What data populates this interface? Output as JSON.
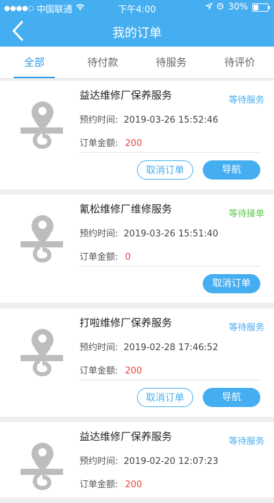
{
  "status_bar": {
    "carrier": "中国联通",
    "time": "下午4:00",
    "battery": "30%"
  },
  "header": {
    "title": "我的订单"
  },
  "tabs": [
    {
      "label": "全部",
      "active": true
    },
    {
      "label": "待付款"
    },
    {
      "label": "待服务"
    },
    {
      "label": "待评价"
    }
  ],
  "colors": {
    "primary": "#45aef0",
    "status_waiting_service": "#45aef0",
    "status_waiting_accept": "#5ac84a",
    "amount": "#e2463d"
  },
  "labels": {
    "time": "预约时间:",
    "amount": "订单金额:"
  },
  "orders": [
    {
      "name": "益达维修厂保养服务",
      "status": "等待服务",
      "time": "2019-03-26 15:52:46",
      "amount": "200",
      "cancel_label": "取消订单",
      "nav_label": "导航"
    },
    {
      "name": "氰松维修厂维修服务",
      "status": "等待接单",
      "time": "2019-03-26 15:51:40",
      "amount": "0",
      "cancel_label": "取消订单"
    },
    {
      "name": "打啦维修厂保养服务",
      "status": "等待服务",
      "time": "2019-02-28 17:46:52",
      "amount": "200",
      "cancel_label": "取消订单",
      "nav_label": "导航"
    },
    {
      "name": "益达维修厂保养服务",
      "status": "等待服务",
      "time": "2019-02-20 12:07:23",
      "amount": "200"
    }
  ]
}
